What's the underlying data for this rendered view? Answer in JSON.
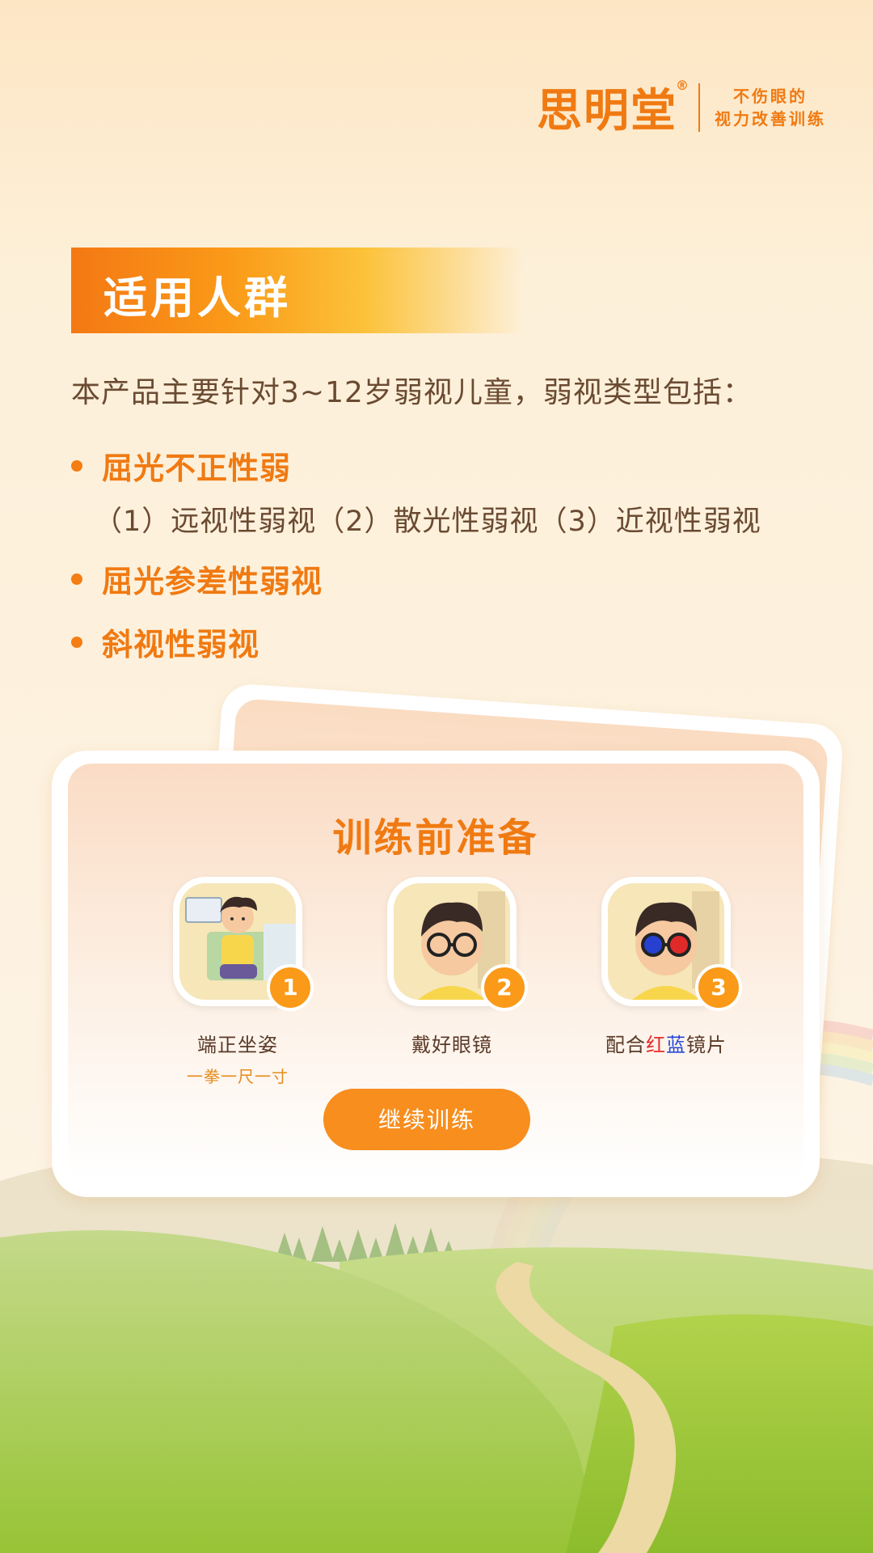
{
  "brand": {
    "name": "思明堂",
    "registered": "®",
    "slogan_line1": "不伤眼的",
    "slogan_line2": "视力改善训练"
  },
  "section": {
    "title": "适用人群",
    "intro": "本产品主要针对3~12岁弱视儿童，弱视类型包括：",
    "items": [
      {
        "label": "屈光不正性弱",
        "subtypes": "（1）远视性弱视（2）散光性弱视（3）近视性弱视"
      },
      {
        "label": "屈光参差性弱视"
      },
      {
        "label": "斜视性弱视"
      }
    ]
  },
  "card": {
    "title": "训练前准备",
    "steps": [
      {
        "number": "1",
        "label": "端正坐姿",
        "sub": "一拳一尺一寸"
      },
      {
        "number": "2",
        "label": "戴好眼镜"
      },
      {
        "number": "3",
        "label_prefix": "配合",
        "label_red": "红",
        "label_blue": "蓝",
        "label_suffix": "镜片"
      }
    ],
    "button_label": "继续训练"
  },
  "colors": {
    "accent": "#f07a12",
    "button": "#f78e1e",
    "badge": "#fa9a18",
    "text": "#6b4a32"
  }
}
